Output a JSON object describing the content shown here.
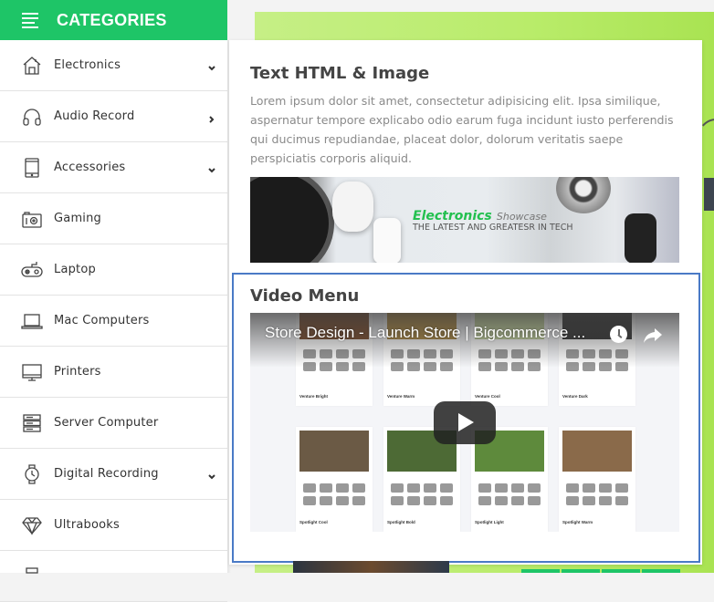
{
  "sidebar": {
    "header": {
      "title": "CATEGORIES",
      "icon": "menu-icon"
    },
    "items": [
      {
        "label": "Electronics",
        "icon": "home-icon",
        "chevron": "down"
      },
      {
        "label": "Audio Record",
        "icon": "headphones-icon",
        "chevron": "right"
      },
      {
        "label": "Accessories",
        "icon": "tablet-icon",
        "chevron": "down"
      },
      {
        "label": "Gaming",
        "icon": "camera-icon",
        "chevron": null
      },
      {
        "label": "Laptop",
        "icon": "gamepad-icon",
        "chevron": null
      },
      {
        "label": "Mac Computers",
        "icon": "laptop-icon",
        "chevron": null
      },
      {
        "label": "Printers",
        "icon": "monitor-icon",
        "chevron": null
      },
      {
        "label": "Server Computer",
        "icon": "server-icon",
        "chevron": null
      },
      {
        "label": "Digital Recording",
        "icon": "watch-icon",
        "chevron": "down"
      },
      {
        "label": "Ultrabooks",
        "icon": "diamond-icon",
        "chevron": null
      }
    ]
  },
  "mega_menu": {
    "text_section": {
      "heading": "Text HTML & Image",
      "paragraph": "Lorem ipsum dolor sit amet, consectetur adipisicing elit. Ipsa similique, aspernatur tempore explicabo odio earum fuga incidunt iusto perferendis qui ducimus repudiandae, placeat dolor, dolorum veritatis saepe perspiciatis corporis aliquid.",
      "banner": {
        "brand_bold": "Electronics",
        "brand_light": "Showcase",
        "tagline": "THE LATEST AND GREATESR IN TECH"
      }
    },
    "video_section": {
      "heading": "Video Menu",
      "video_title": "Store Design - Launch Store | Bigcommerce ...",
      "thumbnails": [
        "Venture Bright",
        "Venture Warm",
        "Venture Cool",
        "Venture Dark",
        "Spotlight Cool",
        "Spotlight Bold",
        "Spotlight Light",
        "Spotlight Warm"
      ]
    }
  },
  "colors": {
    "brand_green": "#1ec567",
    "highlight_border": "#4a7ac6",
    "hero_green": "#b9ec6a"
  }
}
